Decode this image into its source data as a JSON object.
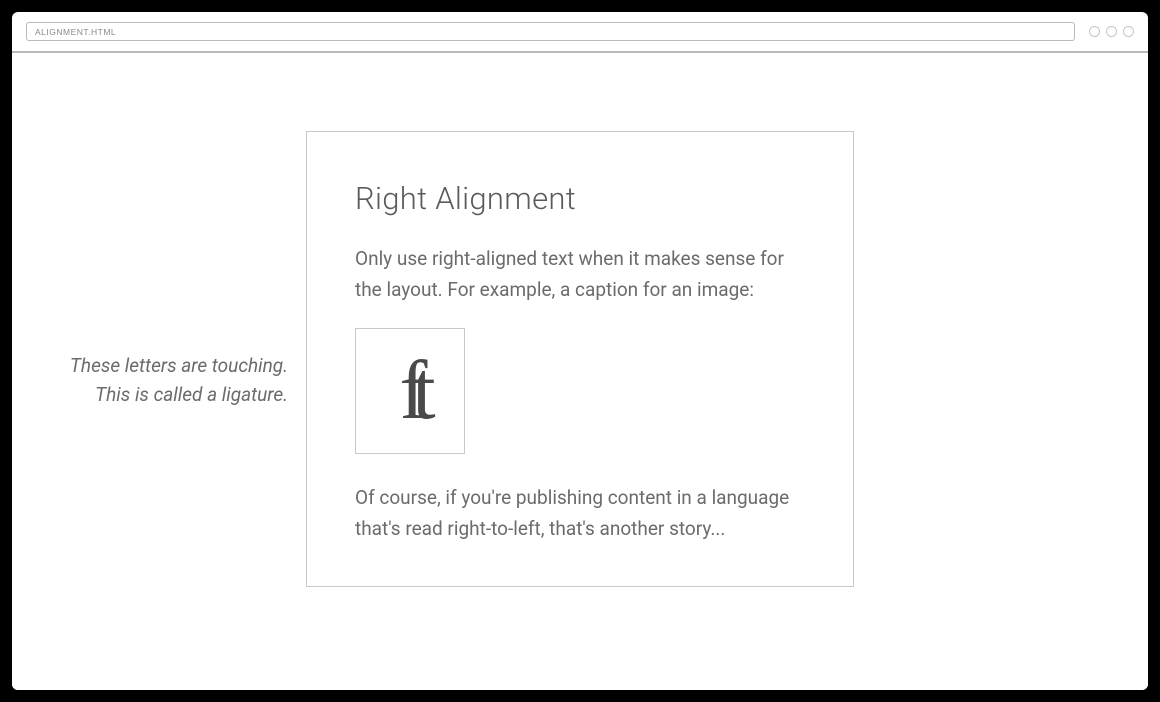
{
  "url_bar": {
    "value": "ALIGNMENT.HTML"
  },
  "card": {
    "heading": "Right Alignment",
    "para1": "Only use right-aligned text when it makes sense for the layout. For example, a caption for an image:",
    "para2": "Of course, if you're publishing content in a language that's read right-to-left, that's another story...",
    "caption_line1": "These letters are touching.",
    "caption_line2": "This is called a ligature.",
    "ligature_text": "ft"
  }
}
